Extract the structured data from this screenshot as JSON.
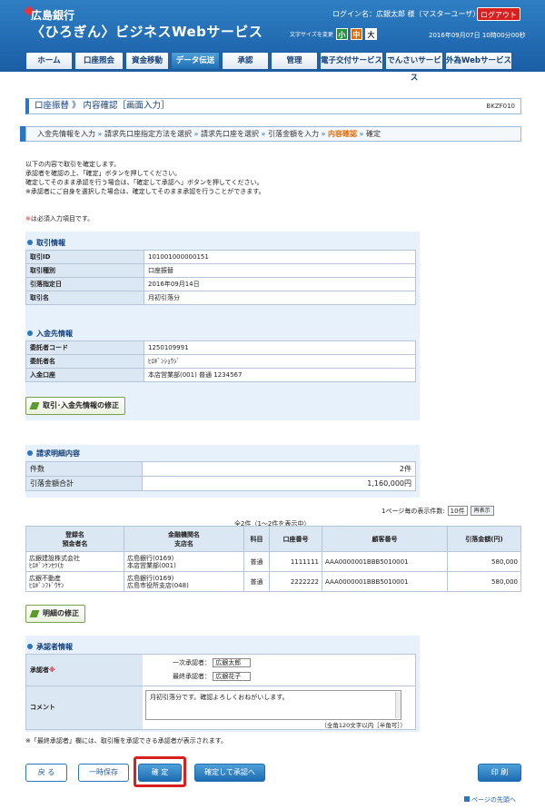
{
  "header": {
    "bank_name": "広島銀行",
    "service_name": "〈ひろぎん〉ビジネスWebサービス",
    "login_label": "ログイン名：",
    "login_user": "広銀太郎 様（マスターユーザ）",
    "logout_label": "ログアウト",
    "font_size_label": "文字サイズを変更",
    "font_sizes": [
      "小",
      "中",
      "大"
    ],
    "datetime": "2016年09月07日 10時00分00秒"
  },
  "nav": [
    "ホーム",
    "口座照会",
    "資金移動",
    "データ伝送",
    "承認",
    "管理",
    "電子交付サービス",
    "でんさいサービス",
    "外為Webサービス"
  ],
  "page": {
    "title": "口座振替 》 内容確認［画面入力］",
    "screen_id": "BKZF010"
  },
  "steps": [
    "入金先情報を入力",
    "請求先口座指定方法を選択",
    "請求先口座を選択",
    "引落金額を入力",
    "内容確認",
    "確定"
  ],
  "intro": [
    "以下の内容で取引を確定します。",
    "承認者を確認の上、「確定」ボタンを押してください。",
    "確定してそのまま承認を行う場合は、「確定して承認へ」ボタンを押してください。",
    "※承認者にご自身を選択した場合は、確定してそのまま承認を行うことができます。"
  ],
  "required_note_mark": "※",
  "required_note": "は必須入力項目です。",
  "transaction": {
    "heading": "取引情報",
    "rows": [
      {
        "k": "取引ID",
        "v": "101001000000151"
      },
      {
        "k": "取引種別",
        "v": "口座振替"
      },
      {
        "k": "引落指定日",
        "v": "2016年09月14日"
      },
      {
        "k": "取引名",
        "v": "月初引落分"
      }
    ]
  },
  "payee": {
    "heading": "入金先情報",
    "rows": [
      {
        "k": "委託者コード",
        "v": "1250109991"
      },
      {
        "k": "委託者名",
        "v": "ﾋﾛｷﾞﾝｼｮｳｼﾞ"
      },
      {
        "k": "入金口座",
        "v": "本店営業部(001) 普通 1234567"
      }
    ]
  },
  "btn_modify_txn": "取引･入金先情報の修正",
  "summary": {
    "heading": "請求明細内容",
    "rows": [
      {
        "k": "件数",
        "v": "2件"
      },
      {
        "k": "引落金額合計",
        "v": "1,160,000円"
      }
    ]
  },
  "pager": {
    "label": "1ページ毎の表示件数:",
    "value": "10件",
    "redisplay": "再表示"
  },
  "record_count": "全2件（1～2件を表示中）",
  "detail": {
    "headers": [
      "登録名\n預金者名",
      "金融機関名\n支店名",
      "科目",
      "口座番号",
      "顧客番号",
      "引落金額(円)"
    ],
    "rows": [
      {
        "name": "広銀建設株式会社",
        "kana": "ﾋﾛｷﾞﾝｹﾝｾﾂ(ｶ",
        "bank": "広島銀行(0169)",
        "branch": "本店営業部(001)",
        "type": "普通",
        "acct": "1111111",
        "cust": "AAA0000001BBB5010001",
        "amt": "580,000"
      },
      {
        "name": "広銀不動産",
        "kana": "ﾋﾛｷﾞﾝﾌﾄﾞｳｻﾝ",
        "bank": "広島銀行(0169)",
        "branch": "広島市役所支店(048)",
        "type": "普通",
        "acct": "2222222",
        "cust": "AAA0000001BBB5010001",
        "amt": "580,000"
      }
    ]
  },
  "btn_modify_detail": "明細の修正",
  "approver": {
    "heading": "承認者情報",
    "label": "承認者",
    "mark": "※",
    "first_label": "一次承認者：",
    "first_value": "広銀太郎",
    "final_label": "最終承認者：",
    "final_value": "広銀花子",
    "comment_label": "コメント",
    "comment_text": "月初引落分です。確認よろしくおねがいします。",
    "comment_hint": "（全角120文字以内［半角可］）"
  },
  "final_note": "※「最終承認者」欄には、取引権を承認できる承認者が表示されます。",
  "footer": {
    "back": "戻 る",
    "temp_save": "一時保存",
    "confirm": "確 定",
    "confirm_approve": "確定して承認へ",
    "print": "印 刷",
    "page_top": "ページの先頭へ"
  }
}
